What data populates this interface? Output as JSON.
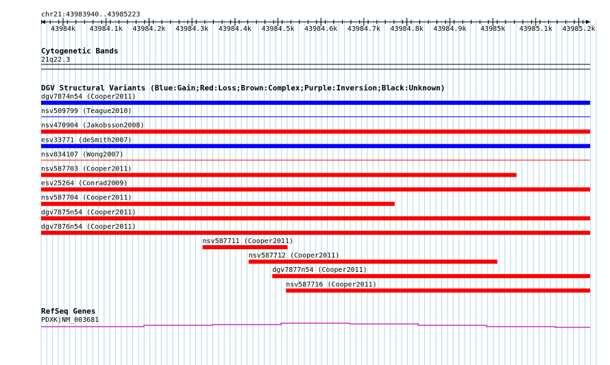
{
  "location": "chr21:43983940..43985223",
  "ruler": {
    "ticks": [
      "43984k",
      "43984.1k",
      "43984.2k",
      "43984.3k",
      "43984.4k",
      "43984.5k",
      "43984.6k",
      "43984.7k",
      "43984.8k",
      "43984.9k",
      "43985k",
      "43985.1k",
      "43985.2k"
    ]
  },
  "colors": {
    "gain": "#0000ff",
    "loss": "#ff0000",
    "gene": "#cc33cc",
    "grid": "#add8e6"
  },
  "cytoband": {
    "title": "Cytogenetic Bands",
    "band": "21q22.3"
  },
  "dgv": {
    "title": "DGV Structural Variants (Blue:Gain;Red:Loss;Brown:Complex;Purple:Inversion;Black:Unknown)",
    "variants": [
      {
        "label": "dgv7874n54 (Cooper2011)",
        "type": "gain",
        "start": 0.0,
        "end": 1.0,
        "thin": false
      },
      {
        "label": "nsv509799 (Teague2010)",
        "type": "gain",
        "start": 0.0,
        "end": 1.0,
        "thin": true
      },
      {
        "label": "nsv470904 (Jakobsson2008)",
        "type": "loss",
        "start": 0.0,
        "end": 1.0,
        "thin": false
      },
      {
        "label": "esv33771 (deSmith2007)",
        "type": "gain",
        "start": 0.0,
        "end": 1.0,
        "thin": false
      },
      {
        "label": "nsv834107 (Wong2007)",
        "type": "loss",
        "start": 0.0,
        "end": 1.0,
        "thin": true
      },
      {
        "label": "nsv587703 (Cooper2011)",
        "type": "loss",
        "start": 0.0,
        "end": 0.866,
        "thin": false
      },
      {
        "label": "esv25264 (Conrad2009)",
        "type": "loss",
        "start": 0.0,
        "end": 1.0,
        "thin": false
      },
      {
        "label": "nsv587704 (Cooper2011)",
        "type": "loss",
        "start": 0.0,
        "end": 0.644,
        "thin": false
      },
      {
        "label": "dgv7875n54 (Cooper2011)",
        "type": "loss",
        "start": 0.0,
        "end": 1.0,
        "thin": false
      },
      {
        "label": "dgv7876n54 (Cooper2011)",
        "type": "loss",
        "start": 0.0,
        "end": 1.0,
        "thin": false
      },
      {
        "label": "nsv587711 (Cooper2011)",
        "type": "loss",
        "start": 0.294,
        "end": 0.449,
        "thin": false
      },
      {
        "label": "nsv587712 (Cooper2011)",
        "type": "loss",
        "start": 0.378,
        "end": 0.831,
        "thin": false
      },
      {
        "label": "dgv7877n54 (Cooper2011)",
        "type": "loss",
        "start": 0.421,
        "end": 1.0,
        "thin": false
      },
      {
        "label": "nsv587716 (Cooper2011)",
        "type": "loss",
        "start": 0.446,
        "end": 1.0,
        "thin": false
      }
    ]
  },
  "refseq": {
    "title": "RefSeq Genes",
    "gene": "PDXK|NM_003681"
  }
}
